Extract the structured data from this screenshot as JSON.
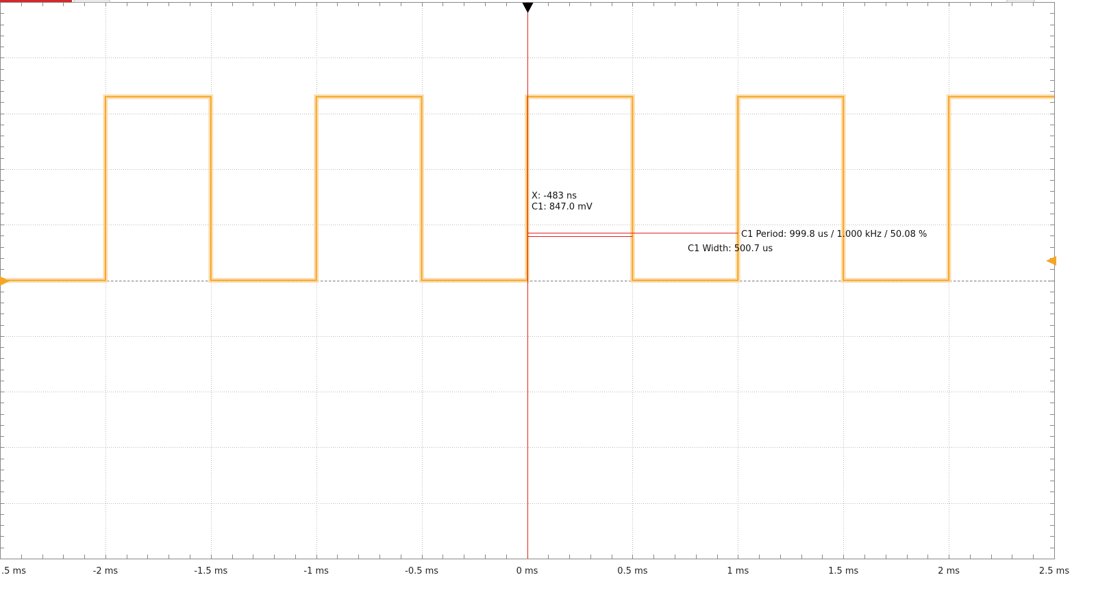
{
  "toolbar": {
    "accent_color": "#d4282a"
  },
  "cursor": {
    "x_readout": "X: -483 ns",
    "c1_readout": "C1: 847.0 mV",
    "color": "#e02020"
  },
  "measurements": {
    "period": "C1 Period: 999.8 us / 1.000 kHz / 50.08 %",
    "width": "C1 Width: 500.7 us"
  },
  "chart_data": {
    "type": "line",
    "x_unit": "ms",
    "xlim": [
      -2.5,
      2.5
    ],
    "x_ticks": [
      -2.5,
      -2,
      -1.5,
      -1,
      -0.5,
      0,
      0.5,
      1,
      1.5,
      2,
      2.5
    ],
    "x_tick_labels": [
      ".5 ms",
      "-2 ms",
      "-1.5 ms",
      "-1 ms",
      "-0.5 ms",
      "0 ms",
      "0.5 ms",
      "1 ms",
      "1.5 ms",
      "2 ms",
      "2.5 ms"
    ],
    "ylim": [
      -5,
      5
    ],
    "grid": true,
    "divisions": {
      "x": 10,
      "y": 10
    },
    "series": [
      {
        "color": "#f5a623",
        "persistence_color": "#fbd9a8",
        "x": [
          -2.5,
          -2.0,
          -2.0,
          -1.5,
          -1.5,
          -1.0,
          -1.0,
          -0.5,
          -0.5,
          0.0,
          0.0,
          0.5,
          0.5,
          1.0,
          1.0,
          1.5,
          1.5,
          2.0,
          2.0,
          2.5
        ],
        "y": [
          0.0,
          0.0,
          3.3,
          3.3,
          0.0,
          0.0,
          3.3,
          3.3,
          0.0,
          0.0,
          3.3,
          3.3,
          0.0,
          0.0,
          3.3,
          3.3,
          0.0,
          0.0,
          3.3,
          3.3
        ]
      }
    ]
  }
}
